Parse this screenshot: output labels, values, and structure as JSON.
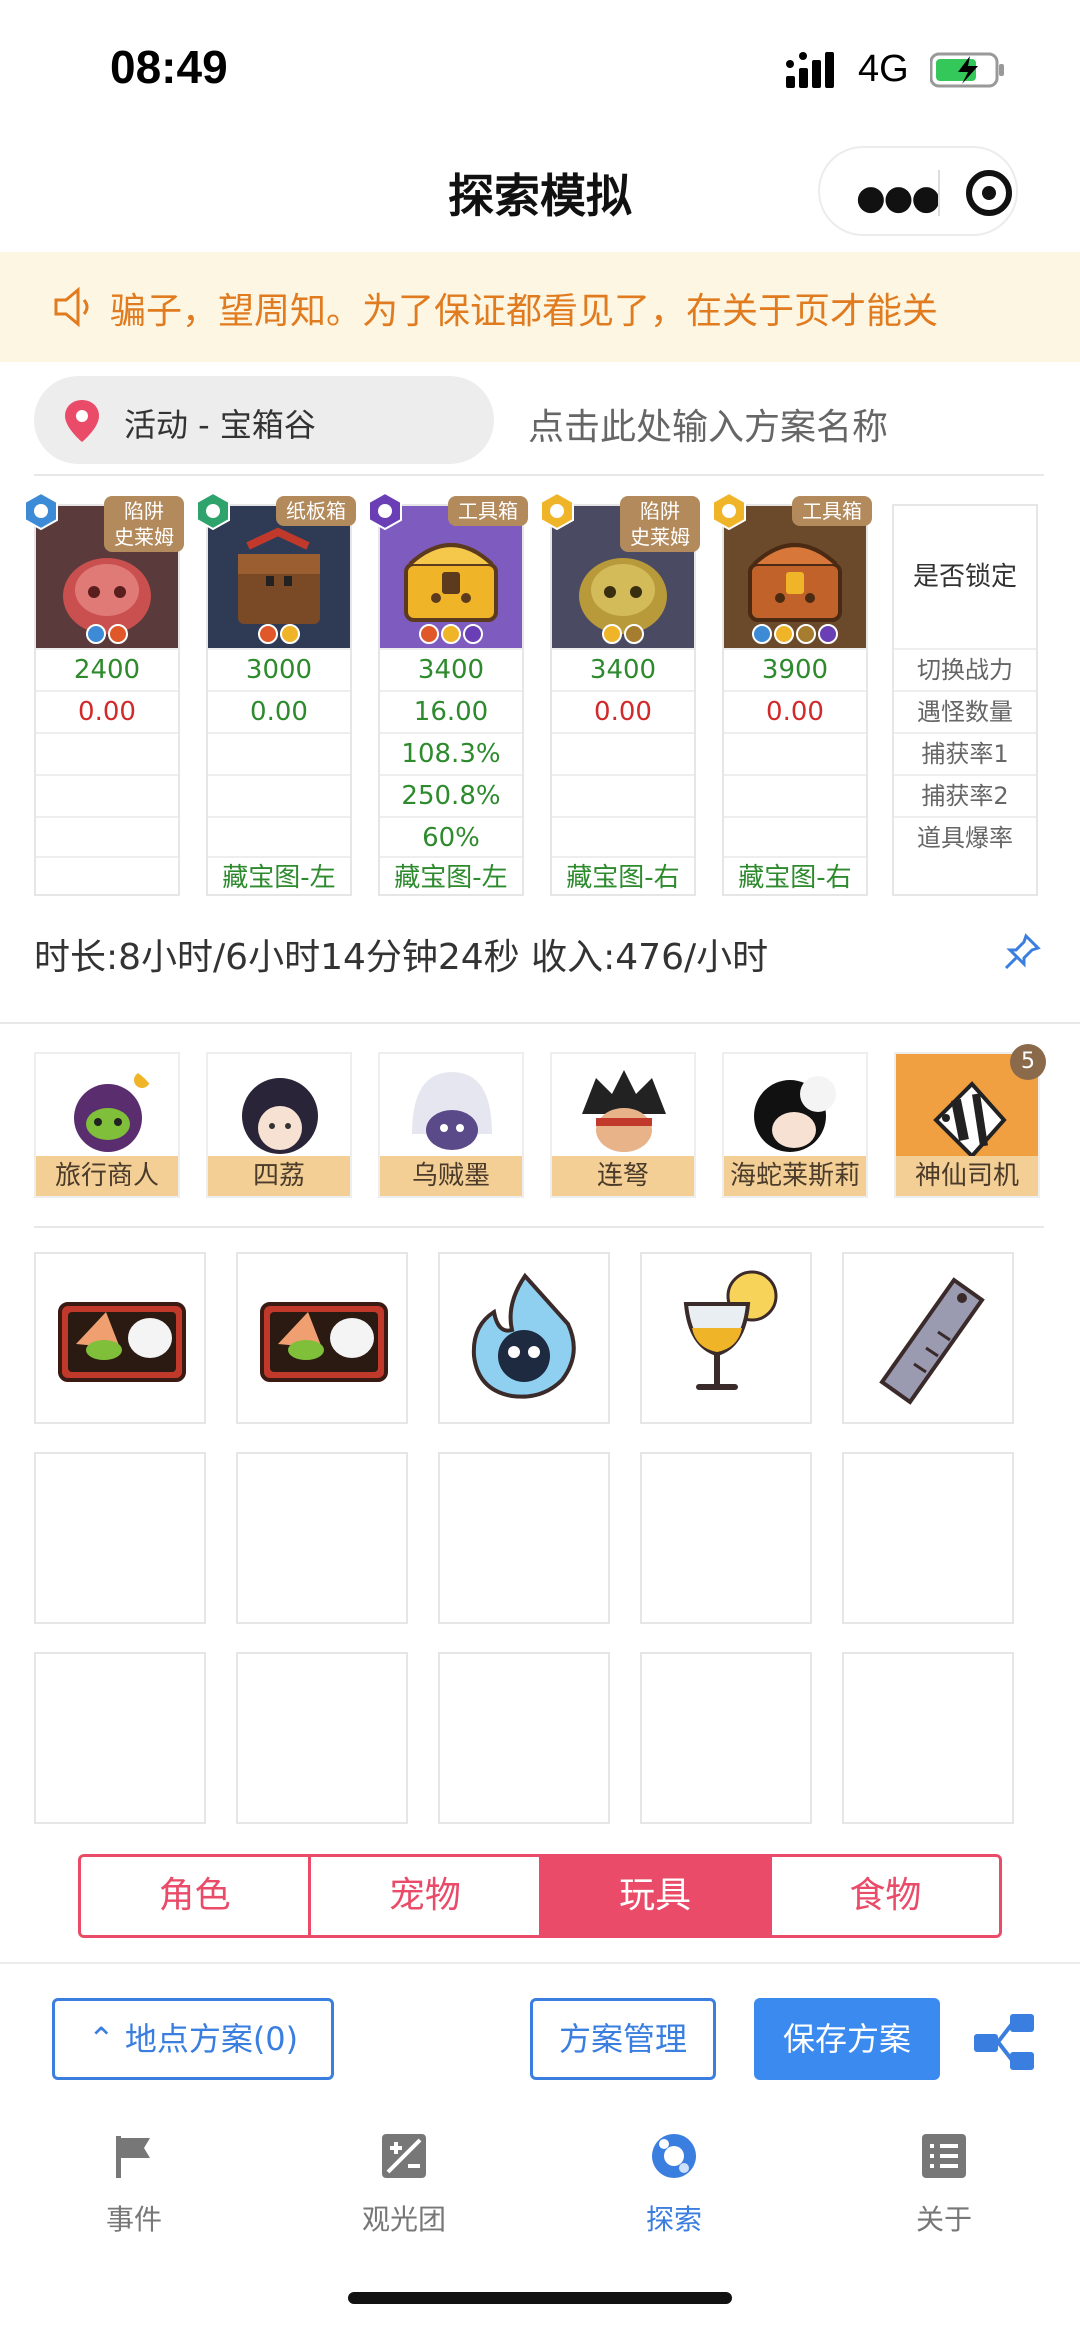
{
  "status_bar": {
    "time": "08:49",
    "network": "4G"
  },
  "nav": {
    "title": "探索模拟",
    "more_icon": "more-icon",
    "target_icon": "target-icon"
  },
  "notice": {
    "text": "骗子，望周知。为了保证都看见了，在关于页才能关"
  },
  "location": {
    "label": "活动 - 宝箱谷",
    "plan_placeholder": "点击此处输入方案名称"
  },
  "monsters": [
    {
      "tag": "陷阱\n史莱姆",
      "power": "2400",
      "encounter": "0.00",
      "cap1": "",
      "cap2": "",
      "drop": "",
      "map": ""
    },
    {
      "tag": "纸板箱",
      "power": "3000",
      "encounter": "0.00",
      "cap1": "",
      "cap2": "",
      "drop": "",
      "map": "藏宝图-左"
    },
    {
      "tag": "工具箱",
      "power": "3400",
      "encounter": "16.00",
      "cap1": "108.3%",
      "cap2": "250.8%",
      "drop": "60%",
      "map": "藏宝图-左"
    },
    {
      "tag": "陷阱\n史莱姆",
      "power": "3400",
      "encounter": "0.00",
      "cap1": "",
      "cap2": "",
      "drop": "",
      "map": "藏宝图-右"
    },
    {
      "tag": "工具箱",
      "power": "3900",
      "encounter": "0.00",
      "cap1": "",
      "cap2": "",
      "drop": "",
      "map": "藏宝图-右"
    }
  ],
  "lock_col": {
    "header": "是否锁定",
    "rows": [
      "切换战力",
      "遇怪数量",
      "捕获率1",
      "捕获率2",
      "道具爆率"
    ]
  },
  "duration": {
    "text": "时长:8小时/6小时14分钟24秒 收入:476/小时"
  },
  "characters": [
    {
      "name": "旅行商人"
    },
    {
      "name": "四荔"
    },
    {
      "name": "乌贼墨"
    },
    {
      "name": "连弩"
    },
    {
      "name": "海蛇莱斯莉"
    },
    {
      "name": "神仙司机",
      "count": "5"
    }
  ],
  "tabs": [
    {
      "label": "角色"
    },
    {
      "label": "宠物"
    },
    {
      "label": "玩具",
      "active": true
    },
    {
      "label": "食物"
    }
  ],
  "actions": {
    "location_plan": "地点方案(0)",
    "manage": "方案管理",
    "save": "保存方案"
  },
  "tabbar": [
    {
      "label": "事件",
      "icon": "flag-icon"
    },
    {
      "label": "观光团",
      "icon": "plus-minus-icon"
    },
    {
      "label": "探索",
      "icon": "explore-icon",
      "active": true
    },
    {
      "label": "关于",
      "icon": "list-icon"
    }
  ],
  "colors": {
    "accent": "#e94b68",
    "primary": "#3a8af0",
    "notice_text": "#e07b1f",
    "value_green": "#2d8a2d",
    "value_red": "#d12a2a"
  }
}
